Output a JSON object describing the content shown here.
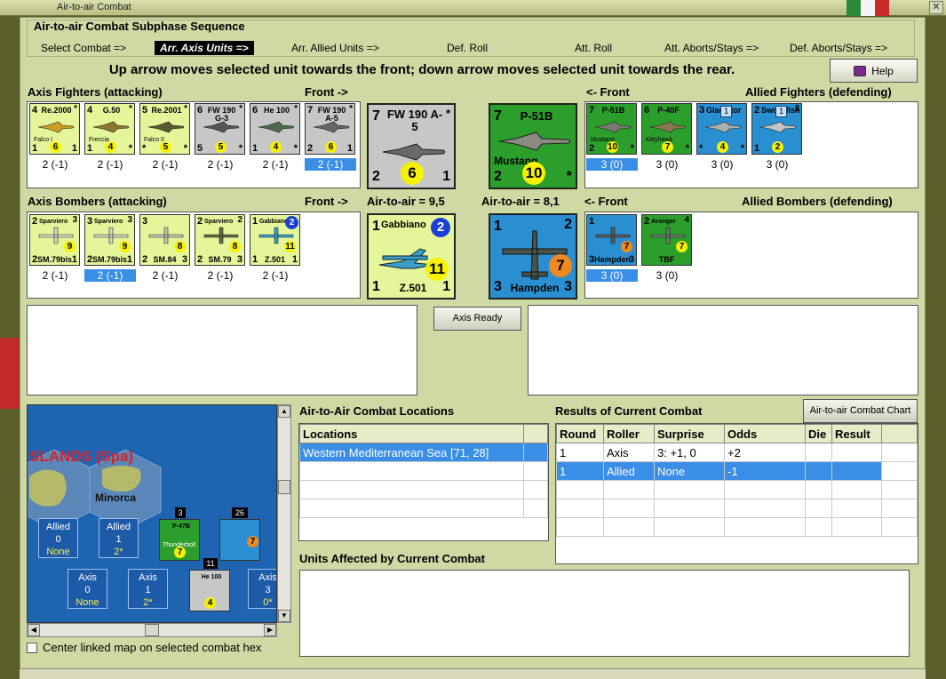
{
  "window": {
    "title": "Air-to-air Combat"
  },
  "sequence": {
    "title": "Air-to-air Combat Subphase Sequence",
    "steps": [
      "Select Combat =>",
      "Arr. Axis Units =>",
      "Arr. Allied Units =>",
      "Def. Roll",
      "Att. Roll",
      "Att. Aborts/Stays =>",
      "Def. Aborts/Stays =>"
    ],
    "active_index": 1
  },
  "instruction": "Up arrow moves selected unit towards the front; down arrow moves selected unit towards the rear.",
  "help_label": "Help",
  "fighters": {
    "axis_header": "Axis Fighters (attacking)",
    "front_right": "Front ->",
    "front_left": "<- Front",
    "allied_header": "Allied Fighters (defending)",
    "axis_units": [
      {
        "name": "Re.2000",
        "sub": "Falco I",
        "tl": "4",
        "tr": "*",
        "bl": "1",
        "br": "1",
        "circle": "6",
        "value": "2 (-1)",
        "color": "yel",
        "plane": "#c9a020"
      },
      {
        "name": "G.50",
        "sub": "Freccia",
        "tl": "4",
        "tr": "*",
        "bl": "1",
        "br": "*",
        "circle": "4",
        "value": "2 (-1)",
        "color": "yel",
        "plane": "#8a7a30"
      },
      {
        "name": "Re.2001",
        "sub": "Falco II",
        "tl": "5",
        "tr": "*",
        "bl": "*",
        "br": "*",
        "circle": "5",
        "value": "2 (-1)",
        "color": "yel",
        "plane": "#5a5a30"
      },
      {
        "name": "FW 190 G-3",
        "sub": "",
        "tl": "6",
        "tr": "*",
        "bl": "5",
        "br": "*",
        "circle": "5",
        "value": "2 (-1)",
        "color": "gry",
        "plane": "#555555"
      },
      {
        "name": "He 100",
        "sub": "",
        "tl": "6",
        "tr": "*",
        "bl": "1",
        "br": "*",
        "circle": "4",
        "value": "2 (-1)",
        "color": "gry",
        "plane": "#4a6a4a"
      },
      {
        "name": "FW 190 A-5",
        "sub": "",
        "tl": "7",
        "tr": "*",
        "bl": "2",
        "br": "1",
        "circle": "6",
        "value": "2 (-1)",
        "color": "gry",
        "plane": "#666666",
        "selected": true
      }
    ],
    "axis_big": {
      "name": "FW 190 A-5",
      "tl": "7",
      "tr": "*",
      "bl": "2",
      "br": "1",
      "circle": "6"
    },
    "allied_big": {
      "name": "P-51B",
      "bname": "Mustang",
      "tl": "7",
      "tr": "",
      "bl": "2",
      "br": "*",
      "circle": "10"
    },
    "allied_units": [
      {
        "name": "P-51B",
        "sub": "Mustang",
        "tl": "7",
        "tr": "",
        "bl": "2",
        "br": "*",
        "circle": "10",
        "value": "3 (0)",
        "color": "grn",
        "plane": "#7a7a70",
        "selected": true
      },
      {
        "name": "P-40F",
        "sub": "Kittyhawk",
        "tl": "6",
        "tr": "",
        "bl": "",
        "br": "*",
        "circle": "7",
        "value": "3 (0)",
        "color": "grn",
        "plane": "#8a7a50"
      },
      {
        "name": "Gladiator",
        "sub": "",
        "tl": "3",
        "tr": "",
        "bl": "*",
        "br": "*",
        "circle": "4",
        "sq": "1",
        "value": "3 (0)",
        "color": "blu",
        "plane": "#aab0b0"
      },
      {
        "name": "Swordfish",
        "sub": "",
        "tl": "2",
        "tr": "3",
        "bl": "1",
        "br": "",
        "circle": "2",
        "sq": "1",
        "value": "3 (0)",
        "color": "blu",
        "plane": "#c0c4c4"
      }
    ]
  },
  "bombers": {
    "axis_header": "Axis Bombers (attacking)",
    "front_right": "Front ->",
    "front_left": "<- Front",
    "allied_header": "Allied Bombers (defending)",
    "axis_odds": "Air-to-air = 9,5",
    "allied_odds": "Air-to-air = 8,1",
    "axis_units": [
      {
        "name": "Sparviero",
        "bname": "SM.79bis",
        "tl": "2",
        "tr": "3",
        "bl": "2",
        "br": "1",
        "circle": "9",
        "value": "2 (-1)",
        "color": "yel",
        "plane": "#d8d8c0"
      },
      {
        "name": "Sparviero",
        "bname": "SM.79bis",
        "tl": "3",
        "tr": "3",
        "bl": "2",
        "br": "1",
        "circle": "9",
        "value": "2 (-1)",
        "color": "yel",
        "plane": "#d8d8c0",
        "selected": true
      },
      {
        "name": "",
        "bname": "SM.84",
        "tl": "3",
        "tr": "",
        "bl": "2",
        "br": "3",
        "circle": "8",
        "value": "2 (-1)",
        "color": "yel",
        "plane": "#c8c8b0"
      },
      {
        "name": "Sparviero",
        "bname": "SM.79",
        "tl": "2",
        "tr": "2",
        "bl": "2",
        "br": "3",
        "circle": "8",
        "value": "2 (-1)",
        "color": "yel",
        "plane": "#6a6a40"
      },
      {
        "name": "Gabbiano",
        "bname": "Z.501",
        "tl": "1",
        "tr": "",
        "bl": "1",
        "br": "1",
        "circle": "11",
        "blue": "2",
        "value": "2 (-1)",
        "color": "yel",
        "plane": "#3aa0c8"
      }
    ],
    "axis_big": {
      "name": "Gabbiano",
      "bname": "Z.501",
      "tl": "1",
      "blue": "2",
      "bl": "1",
      "br": "1",
      "circle": "11"
    },
    "allied_big": {
      "bname": "Hampden",
      "tl": "1",
      "tr": "2",
      "bl": "3",
      "br": "3",
      "circle": "7"
    },
    "allied_units": [
      {
        "name": "",
        "bname": "Hampden",
        "tl": "1",
        "tr": "",
        "bl": "3",
        "br": "3",
        "circle": "7",
        "value": "3 (0)",
        "color": "blu",
        "plane": "#555a55",
        "selected": true
      },
      {
        "name": "Avenger",
        "bname": "TBF",
        "tl": "2",
        "tr": "4",
        "bl": "",
        "br": "",
        "circle": "7",
        "value": "3 (0)",
        "color": "grn",
        "plane": "#6a7a6a"
      }
    ]
  },
  "axis_ready_label": "Axis Ready",
  "map": {
    "label": "SLANDS (Spa)",
    "island": "Minorca",
    "boxes": [
      {
        "side": "Allied",
        "v1": "0",
        "v2": "None"
      },
      {
        "side": "Allied",
        "v1": "1",
        "v2": "2*"
      },
      {
        "side": "Axis",
        "v1": "0",
        "v2": "None"
      },
      {
        "side": "Axis",
        "v1": "1",
        "v2": "2*"
      },
      {
        "side": "Axis",
        "v1": "3",
        "v2": "0*"
      }
    ],
    "stacks": [
      {
        "count": "3",
        "name": "P-47B",
        "sub": "Thunderbolt",
        "circle": "7"
      },
      {
        "count": "26",
        "name": "",
        "sub": "",
        "circle": "7"
      },
      {
        "count": "11",
        "name": "He 100",
        "sub": "",
        "circle": "4"
      }
    ],
    "center_label": "Center linked map on selected combat hex"
  },
  "locations": {
    "title": "Air-to-Air Combat Locations",
    "header": "Locations",
    "rows": [
      "Western Mediterranean Sea [71, 28]"
    ]
  },
  "results": {
    "title": "Results of Current Combat",
    "chart_button": "Air-to-air Combat Chart",
    "columns": [
      "Round",
      "Roller",
      "Surprise",
      "Odds",
      "Die",
      "Result"
    ],
    "rows": [
      [
        "1",
        "Axis",
        "3: +1, 0",
        "+2",
        "",
        ""
      ],
      [
        "1",
        "Allied",
        "None",
        "-1",
        "",
        ""
      ]
    ]
  },
  "affected": {
    "title": "Units Affected by Current Combat"
  },
  "colors": {
    "panel": "#cfd9a4",
    "selected": "#3a8ee6",
    "allied_green": "#2c9e2c",
    "allied_blue": "#2a8fd0",
    "axis_yellow": "#e5f59a",
    "axis_grey": "#c7c7c7"
  }
}
